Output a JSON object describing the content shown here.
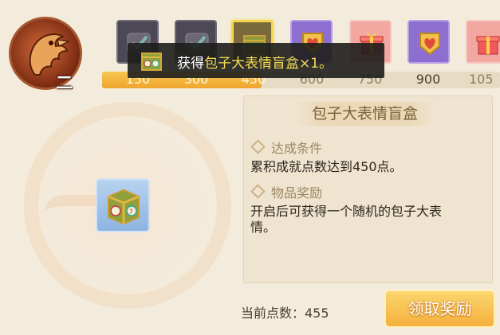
{
  "player": {
    "rank_label": "二"
  },
  "rewards": {
    "thresholds": [
      "150",
      "300",
      "450",
      "600",
      "750",
      "900",
      "105"
    ],
    "progress_points": 455,
    "selected_index": 2,
    "slots": [
      {
        "icon": "gray-badge-icon"
      },
      {
        "icon": "gray-badge-icon"
      },
      {
        "icon": "mystery-box-icon"
      },
      {
        "icon": "heart-badge-icon"
      },
      {
        "icon": "gift-box-icon"
      },
      {
        "icon": "heart-badge-icon"
      },
      {
        "icon": "gift-box-icon"
      }
    ]
  },
  "toast": {
    "prefix": "获得",
    "item": "包子大表情盲盒",
    "suffix": "×1。"
  },
  "detail": {
    "title": "包子大表情盲盒",
    "condition_label": "达成条件",
    "condition_text": "累积成就点数达到450点。",
    "reward_label": "物品奖励",
    "reward_text_line1": "开启后可获得一个随机的包子大表",
    "reward_text_line2": "情。"
  },
  "footer": {
    "points_text": "当前点数：455",
    "claim_button": "领取奖励"
  },
  "colors": {
    "accent": "#f4b03c",
    "highlight": "#f6de55"
  }
}
